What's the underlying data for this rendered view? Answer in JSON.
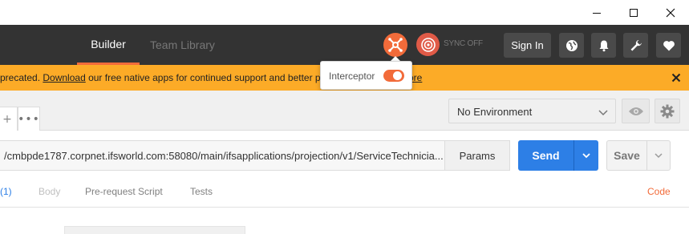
{
  "window": {
    "minimize_icon": "minimize-icon",
    "maximize_icon": "maximize-icon",
    "close_icon": "close-icon"
  },
  "header": {
    "tabs": [
      {
        "label": "Builder",
        "active": true
      },
      {
        "label": "Team Library",
        "active": false
      }
    ],
    "sync_label": "SYNC OFF",
    "sign_in_label": "Sign In",
    "accent_color": "#f26b3a",
    "icons": [
      "interceptor-icon",
      "sync-icon",
      "globe-icon",
      "bell-icon",
      "wrench-icon",
      "heart-icon"
    ]
  },
  "banner": {
    "text_before_link": "precated. ",
    "link_text": "Download",
    "text_after_link": " our free native apps for continued support and better p",
    "trailing_link_text": "ore",
    "background": "#fcab27"
  },
  "interceptor_popover": {
    "label": "Interceptor",
    "enabled": true
  },
  "tabs_bar": {
    "add_label": "+",
    "more_label": "•••"
  },
  "environment": {
    "selected": "No Environment"
  },
  "request": {
    "url": "/cmbpde1787.corpnet.ifsworld.com:58080/main/ifsapplications/projection/v1/ServiceTechnicia...",
    "params_label": "Params",
    "send_label": "Send",
    "save_label": "Save",
    "send_color": "#2d7fe6"
  },
  "request_tabs": {
    "count_label": "(1)",
    "body_label": "Body",
    "pre_request_label": "Pre-request Script",
    "tests_label": "Tests",
    "code_label": "Code"
  }
}
